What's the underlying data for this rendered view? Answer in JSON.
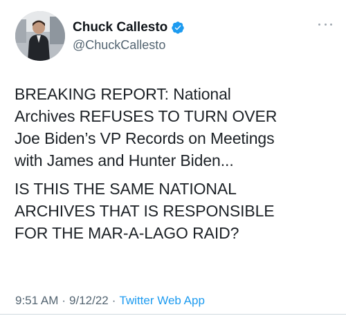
{
  "author": {
    "display_name": "Chuck Callesto",
    "handle": "@ChuckCallesto",
    "verified": true,
    "verified_icon": "verified-badge-icon",
    "avatar_icon": "profile-photo"
  },
  "menu_icon": "more-options-icon",
  "tweet": {
    "paragraphs": [
      "BREAKING REPORT: National\nArchives REFUSES TO TURN OVER\nJoe Biden’s VP Records on Meetings\nwith James and Hunter Biden...",
      "IS THIS THE SAME NATIONAL\nARCHIVES THAT IS RESPONSIBLE\nFOR THE MAR-A-LAGO RAID?"
    ]
  },
  "meta": {
    "time": "9:51 AM",
    "separator": "·",
    "date": "9/12/22",
    "source": "Twitter Web App"
  },
  "colors": {
    "accent": "#1d9bf0",
    "secondary_text": "#536471",
    "primary_text": "#0f1419"
  }
}
